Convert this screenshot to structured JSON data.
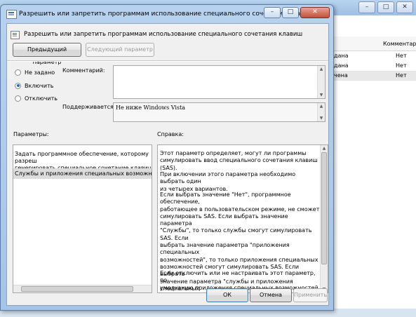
{
  "background_window": {
    "column_header": "Комментар",
    "rows": [
      {
        "left": "дана",
        "right": "Нет"
      },
      {
        "left": "дана",
        "right": "Нет"
      },
      {
        "left": "чена",
        "right": "Нет"
      }
    ]
  },
  "dialog": {
    "title": "Разрешить или запретить программам использование специального сочетания клавиш",
    "header_title": "Разрешить или запретить программам использование специального сочетания клавиш",
    "prev_button": "Предыдущий параметр",
    "next_button": "Следующий параметр",
    "radios": {
      "not_configured": "Не задано",
      "enabled": "Включить",
      "disabled": "Отключить"
    },
    "comment_label": "Комментарий:",
    "supported_label": "Поддерживается:",
    "supported_value": "Не ниже Windows Vista",
    "options_label": "Параметры:",
    "help_label": "Справка:",
    "options_text": "Задать программное обеспечение, которому разреш\nгенерировать специальное сочетание клавиш",
    "options_selected": "Службы и приложения специальных возможностей",
    "help": {
      "p1": "Этот параметр определяет, могут ли программы\nсимулировать ввод специального сочетания клавиш (SAS).",
      "p2": "При включении этого параметра необходимо выбрать один\nиз четырех вариантов.",
      "p3": "Если выбрать значение \"Нет\", программное обеспечение,\nработающее в пользовательском режиме, не сможет\nсимулировать SAS. Если выбрать значение параметра\n\"Службы\", то только службы смогут симулировать SAS. Если\nвыбрать значение параметра \"приложения специальных\nвозможностей\", то только приложения специальных\nвозможностей смогут симулировать SAS. Если выбрать\nзначение параметра \"службы и приложения специальных\nвозможностей\", то службы и приложения специальных\nвозможностей смогут симулировать SAS.",
      "p4": "Если отключить или не настраивать этот параметр, по\nумолчанию приложения специальных возможностей на"
    },
    "ok_button": "ОК",
    "cancel_button": "Отмена",
    "apply_button": "Применить",
    "selected_option": "enabled"
  }
}
